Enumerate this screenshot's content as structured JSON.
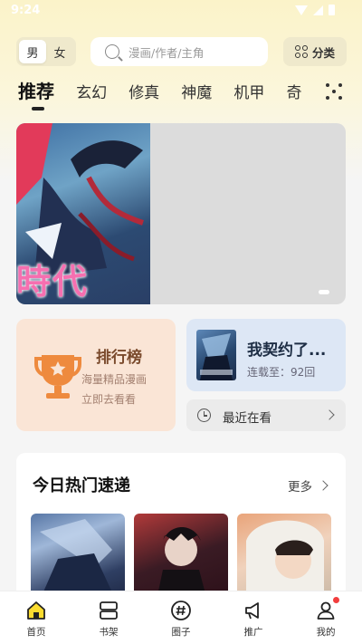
{
  "status_bar": {
    "time": "9:24"
  },
  "top_bar": {
    "gender": {
      "male": "男",
      "female": "女",
      "selected": "男"
    },
    "search": {
      "placeholder": "漫画/作者/主角"
    },
    "category_label": "分类"
  },
  "tabs": [
    "推荐",
    "玄幻",
    "修真",
    "神魔",
    "机甲",
    "奇"
  ],
  "active_tab": "推荐",
  "banner": {
    "text": "時代",
    "carousel_index": 1
  },
  "ranking_card": {
    "title": "排行榜",
    "line1": "海量精品漫画",
    "line2": "立即去看看"
  },
  "continue_card": {
    "title": "我契约了...",
    "status": "连载至：92回"
  },
  "recent": {
    "label": "最近在看"
  },
  "hot": {
    "title": "今日热门速递",
    "more": "更多"
  },
  "bottom_nav": [
    {
      "label": "首页",
      "icon": "home-icon",
      "active": true
    },
    {
      "label": "书架",
      "icon": "bookshelf-icon",
      "active": false
    },
    {
      "label": "圈子",
      "icon": "hashtag-icon",
      "active": false
    },
    {
      "label": "推广",
      "icon": "megaphone-icon",
      "active": false
    },
    {
      "label": "我的",
      "icon": "profile-icon",
      "active": false,
      "badge": true
    }
  ],
  "colors": {
    "accent_yellow": "#fbdc2f",
    "rank_card_bg": "#fae5d6",
    "continue_card_bg": "#dde7f5",
    "trophy": "#ee8a3e",
    "badge_red": "#f23d3d"
  }
}
